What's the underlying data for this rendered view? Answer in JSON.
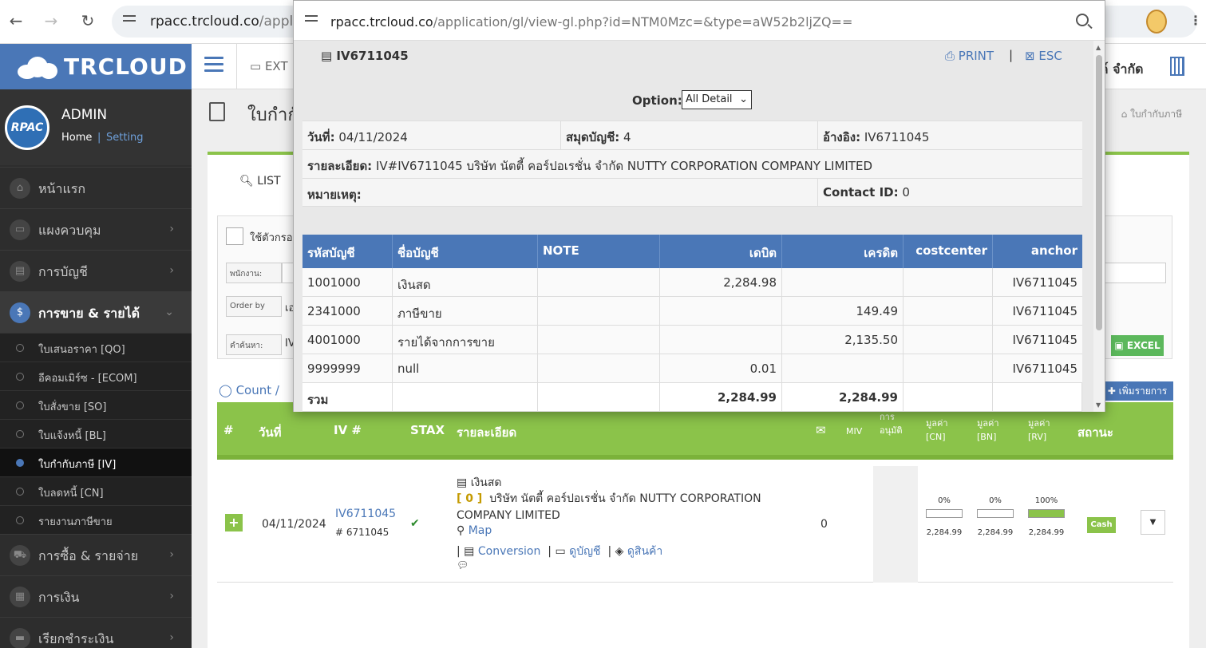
{
  "browser": {
    "url_host": "rpacc.trcloud.co",
    "url_path": "/applic"
  },
  "sidebar": {
    "logo": "TRCLOUD",
    "avatar_text": "RPAC",
    "user": "ADMIN",
    "home": "Home",
    "sep": "|",
    "setting": "Setting",
    "menu": [
      {
        "label": "หน้าแรก",
        "icon": "home-icon"
      },
      {
        "label": "แผงควบคุม",
        "icon": "monitor-icon"
      },
      {
        "label": "การบัญชี",
        "icon": "book-icon"
      },
      {
        "label": "การขาย & รายได้",
        "icon": "dollar-icon"
      },
      {
        "label": "การซื้อ & รายจ่าย",
        "icon": "cart-icon"
      },
      {
        "label": "การเงิน",
        "icon": "calendar-icon"
      },
      {
        "label": "เรียกชำระเงิน",
        "icon": "card-icon"
      }
    ],
    "submenu": [
      {
        "label": "ใบเสนอราคา [QO]"
      },
      {
        "label": "อีคอมเมิร์ซ - [ECOM]"
      },
      {
        "label": "ใบสั่งขาย [SO]"
      },
      {
        "label": "ใบแจ้งหนี้ [BL]"
      },
      {
        "label": "ใบกำกับภาษี [IV]"
      },
      {
        "label": "ใบลดหนี้ [CN]"
      },
      {
        "label": "รายงานภาษีขาย"
      }
    ]
  },
  "topbar": {
    "ext_label": "EXT",
    "company_tail": "งค์ จำกัด"
  },
  "page": {
    "title": "ใบกำกั",
    "breadcrumb": "ใบกำกับภาษี",
    "tab_list": "LIST",
    "filter_check_label": "ใช้ตัวกรอง",
    "filter_staff": "พนักงาน:",
    "filter_order": "Order by",
    "filter_order_val": "เอ",
    "filter_search": "คำค้นหา:",
    "filter_search_val": "IV",
    "excel": "EXCEL",
    "count": "Count",
    "count_sep": "/",
    "add": "เพิ่มรายการ"
  },
  "grid": {
    "headers": {
      "num": "#",
      "date": "วันที่",
      "iv": "IV #",
      "stax": "STAX",
      "detail": "รายละเอียด",
      "miv": "MIV",
      "approve": "การ\nอนุมัติ",
      "cn": "มูลค่า\n[CN]",
      "bn": "มูลค่า\n[BN]",
      "rv": "มูลค่า\n[RV]",
      "status": "สถานะ"
    },
    "row": {
      "date": "04/11/2024",
      "iv": "IV6711045",
      "iv_sub": "6711045",
      "stax": "✔",
      "pay_method": "เงินสด",
      "code_tag": "[ 0 ]",
      "customer": "บริษัท นัตตี้ คอร์ปอเรชั่น จำกัด NUTTY CORPORATION COMPANY LIMITED",
      "map": "Map",
      "conversion": "Conversion",
      "view_acc": "ดูบัญชี",
      "view_goods": "ดูสินค้า",
      "miv_val": "0",
      "cn_pct": "0%",
      "bn_pct": "0%",
      "rv_pct": "100%",
      "cn_progress": 0,
      "bn_progress": 0,
      "rv_progress": 100,
      "cn_amt": "2,284.99",
      "bn_amt": "2,284.99",
      "rv_amt": "2,284.99",
      "status": "Cash"
    }
  },
  "popup": {
    "url_host": "rpacc.trcloud.co",
    "url_path": "/application/gl/view-gl.php?id=NTM0Mzc=&type=aW52b2ljZQ==",
    "doc_no": "IV6711045",
    "print": "PRINT",
    "pipe": "|",
    "esc": "ESC",
    "option_label": "Option:",
    "option_value": "All Detail",
    "date_label": "วันที่:",
    "date_val": "04/11/2024",
    "book_label": "สมุดบัญชี:",
    "book_val": "4",
    "ref_label": "อ้างอิง:",
    "ref_val": "IV6711045",
    "desc_label": "รายละเอียด:",
    "desc_val": "IV#IV6711045 บริษัท นัตตี้ คอร์ปอเรชั่น จำกัด NUTTY CORPORATION COMPANY LIMITED",
    "remark_label": "หมายเหตุ:",
    "contact_label": "Contact ID:",
    "contact_val": "0",
    "columns": [
      "รหัสบัญชี",
      "ชื่อบัญชี",
      "NOTE",
      "เดบิต",
      "เครดิต",
      "costcenter",
      "anchor"
    ],
    "rows": [
      {
        "code": "1001000",
        "name": "เงินสด",
        "note": "",
        "debit": "2,284.98",
        "credit": "",
        "cc": "",
        "anchor": "IV6711045"
      },
      {
        "code": "2341000",
        "name": "ภาษีขาย",
        "note": "",
        "debit": "",
        "credit": "149.49",
        "cc": "",
        "anchor": "IV6711045"
      },
      {
        "code": "4001000",
        "name": "รายได้จากการขาย",
        "note": "",
        "debit": "",
        "credit": "2,135.50",
        "cc": "",
        "anchor": "IV6711045"
      },
      {
        "code": "9999999",
        "name": "null",
        "note": "",
        "debit": "0.01",
        "credit": "",
        "cc": "",
        "anchor": "IV6711045"
      }
    ],
    "total_label": "รวม",
    "total_debit": "2,284.99",
    "total_credit": "2,284.99"
  }
}
